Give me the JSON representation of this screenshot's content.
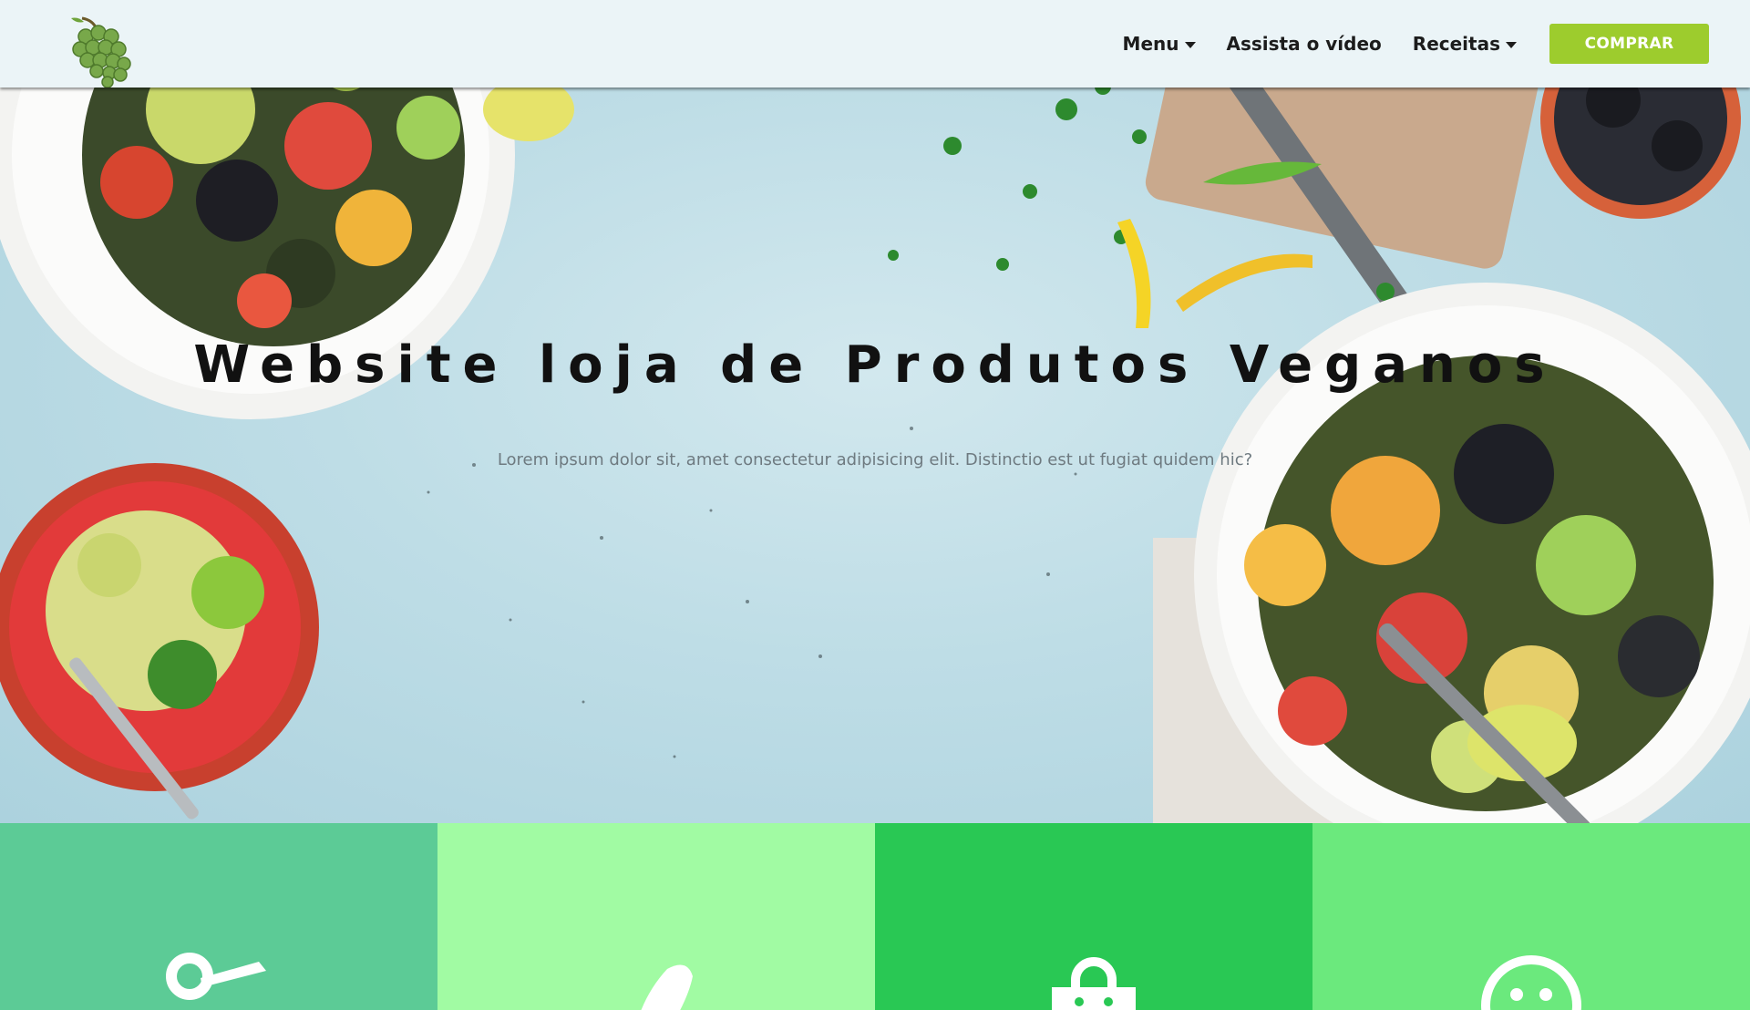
{
  "navbar": {
    "logo_icon": "grapes-icon",
    "items": [
      {
        "label": "Menu",
        "has_dropdown": true
      },
      {
        "label": "Assista o vídeo",
        "has_dropdown": false
      },
      {
        "label": "Receitas",
        "has_dropdown": true
      }
    ],
    "buy_label": "COMPRAR",
    "buy_color": "#9dcc2d",
    "background": "#ebf4f7"
  },
  "hero": {
    "title": "Website loja de Produtos Veganos",
    "subtitle": "Lorem ipsum dolor sit, amet consectetur adipisicing elit. Distinctio est ut fugiat quidem hic?"
  },
  "features": [
    {
      "icon": "scissors-icon",
      "color": "#5ccb96"
    },
    {
      "icon": "knife-icon",
      "color": "#a1fba3"
    },
    {
      "icon": "shopping-bag-icon",
      "color": "#29c854"
    },
    {
      "icon": "smile-icon",
      "color": "#6be97d"
    }
  ]
}
